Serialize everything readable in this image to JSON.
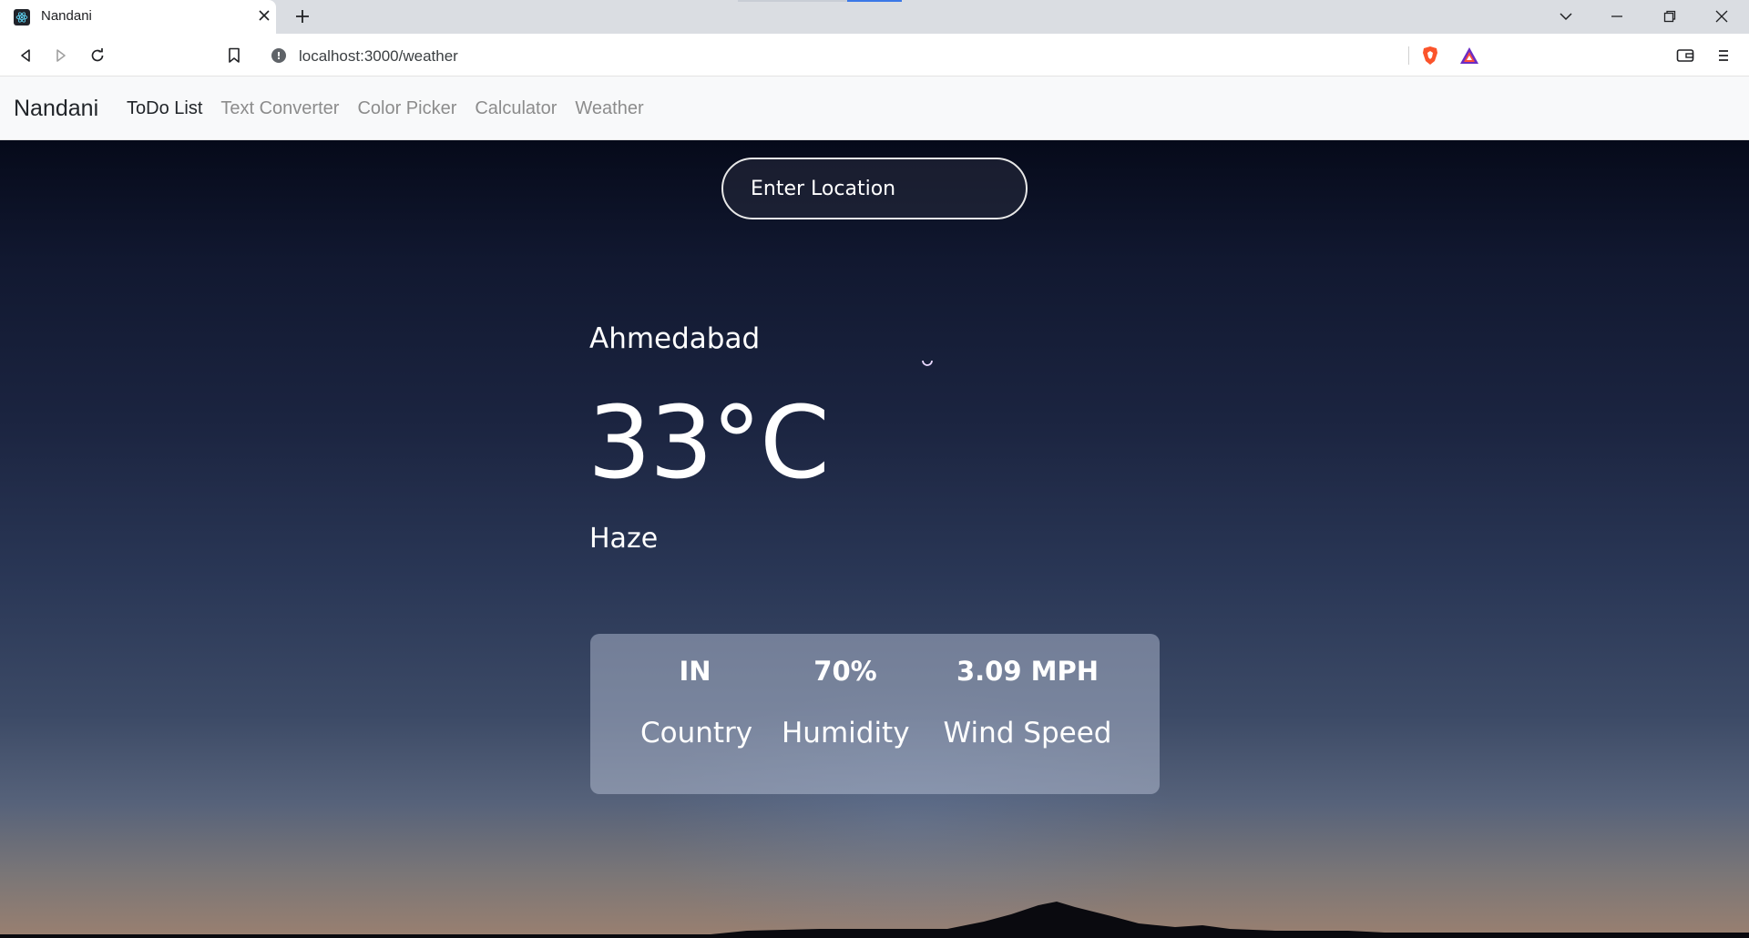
{
  "browser": {
    "tab_title": "Nandani",
    "url": "localhost:3000/weather"
  },
  "navbar": {
    "brand": "Nandani",
    "links": [
      "ToDo List",
      "Text Converter",
      "Color Picker",
      "Calculator",
      "Weather"
    ]
  },
  "weather": {
    "location_placeholder": "Enter Location",
    "city": "Ahmedabad",
    "temperature": "33°C",
    "condition": "Haze",
    "stats": [
      {
        "value": "IN",
        "label": "Country"
      },
      {
        "value": "70%",
        "label": "Humidity"
      },
      {
        "value": "3.09 MPH",
        "label": "Wind Speed"
      }
    ]
  }
}
